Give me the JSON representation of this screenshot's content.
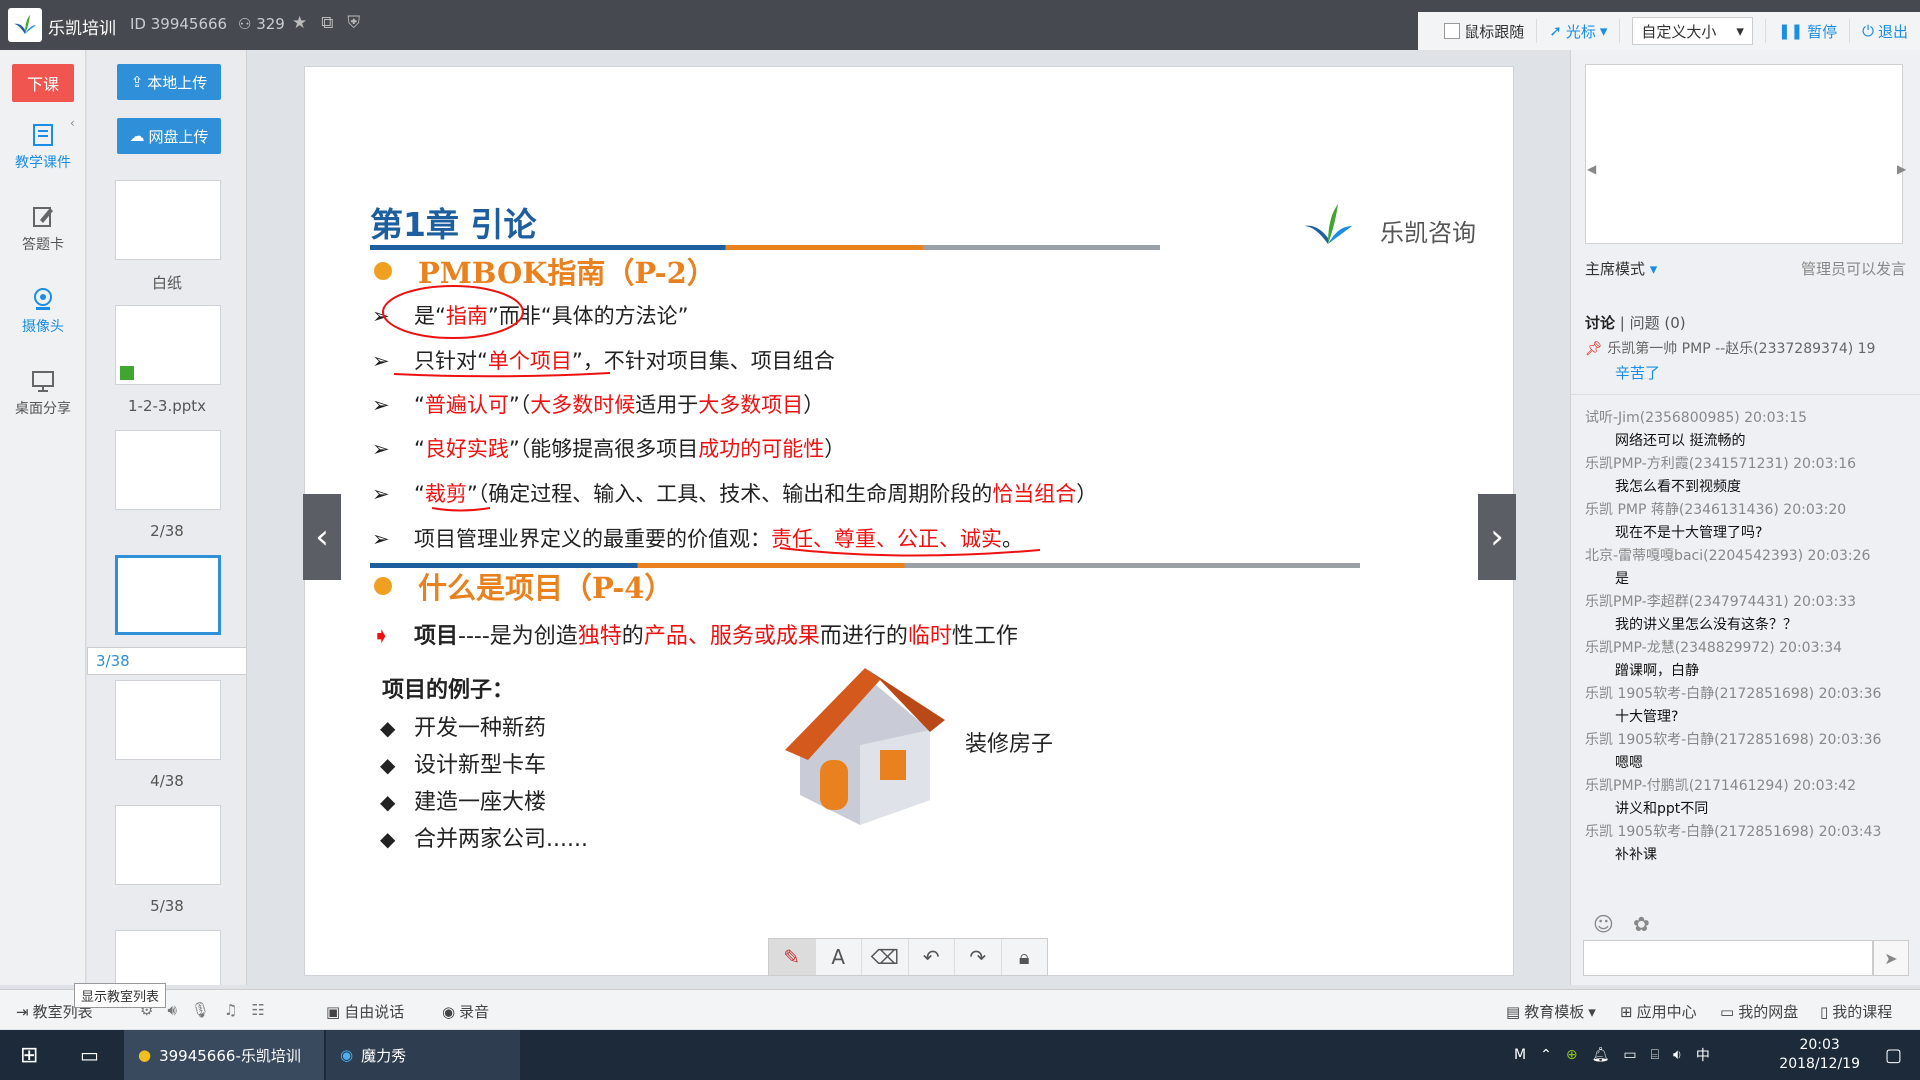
{
  "topbar": {
    "app_title": "乐凯培训",
    "room_id": "ID 39945666",
    "user_count": "329",
    "follow_mouse": "鼠标跟随",
    "cursor": "光标",
    "size_select": "自定义大小",
    "pause": "暂停",
    "exit": "退出"
  },
  "leftnav": {
    "end_class": "下课",
    "items": [
      {
        "label": "教学课件"
      },
      {
        "label": "答题卡"
      },
      {
        "label": "摄像头"
      },
      {
        "label": "桌面分享"
      }
    ]
  },
  "thumbs": {
    "local_upload": "本地上传",
    "cloud_upload": "网盘上传",
    "items": [
      {
        "label": "白纸"
      },
      {
        "label": "1-2-3.pptx"
      },
      {
        "label": "2/38"
      },
      {
        "label": "3/38"
      },
      {
        "label": "4/38"
      },
      {
        "label": "5/38"
      }
    ]
  },
  "slide": {
    "title": "第1章 引论",
    "brand": "乐凯咨询",
    "section1": "PMBOK指南（P-2）",
    "bullets": [
      {
        "parts": [
          "是“",
          "指南",
          "”而非“具体的方法论”"
        ]
      },
      {
        "parts": [
          "只针对“",
          "单个项目",
          "”，不针对项目集、项目组合"
        ]
      },
      {
        "parts": [
          "“",
          "普遍认可",
          "”（",
          "大多数时候",
          "适用于",
          "大多数项目",
          "）"
        ]
      },
      {
        "parts": [
          "“",
          "良好实践",
          "”（能够提高很多项目",
          "成功的可能性",
          "）"
        ]
      },
      {
        "parts": [
          "“",
          "裁剪",
          "”（确定过程、输入、工具、技术、输出和生命周期阶段的",
          "恰当组合",
          "）"
        ]
      },
      {
        "parts": [
          "项目管理业界定义的最重要的价值观：",
          "责任、尊重、公正、诚实",
          "。"
        ]
      }
    ],
    "section2": "什么是项目（P-4）",
    "def": {
      "parts": [
        "项目",
        "----是为创造",
        "独特",
        "的",
        "产品、服务或成果",
        "而进行的",
        "临时",
        "性工作"
      ]
    },
    "examples_title": "项目的例子：",
    "examples": [
      "开发一种新药",
      "设计新型卡车",
      "建造一座大楼",
      "合并两家公司......"
    ],
    "house_label": "装修房子"
  },
  "right": {
    "mode": "主席模式",
    "mode_note": "管理员可以发言",
    "tab_discuss": "讨论",
    "tab_questions": "问题 (0)",
    "pinned_who": "乐凯第一帅 PMP --赵乐(2337289374) 19",
    "pinned_msg": "辛苦了",
    "messages": [
      {
        "who": "试听-Jim(2356800985) 20:03:15",
        "text": "网络还可以 挺流畅的"
      },
      {
        "who": "乐凯PMP-方利霞(2341571231) 20:03:16",
        "text": "我怎么看不到视频度"
      },
      {
        "who": "乐凯 PMP 蒋静(2346131436) 20:03:20",
        "text": "现在不是十大管理了吗?"
      },
      {
        "who": "北京-雷蒂嘎嘎baci(2204542393) 20:03:26",
        "text": "是"
      },
      {
        "who": "乐凯PMP-李超群(2347974431) 20:03:33",
        "text": "我的讲义里怎么没有这条？？"
      },
      {
        "who": "乐凯PMP-龙慧(2348829972) 20:03:34",
        "text": "蹭课啊，白静"
      },
      {
        "who": "乐凯 1905软考-白静(2172851698) 20:03:36",
        "text": "十大管理?"
      },
      {
        "who": "乐凯 1905软考-白静(2172851698) 20:03:36",
        "text": "嗯嗯"
      },
      {
        "who": "乐凯PMP-付鹏凯(2171461294) 20:03:42",
        "text": "讲义和ppt不同"
      },
      {
        "who": "乐凯 1905软考-白静(2172851698) 20:03:43",
        "text": "补补课"
      }
    ]
  },
  "bottombar": {
    "classroom": "教室列表",
    "tooltip": "显示教室列表",
    "free_talk": "自由说话",
    "record": "录音",
    "edu_template": "教育模板",
    "app_center": "应用中心",
    "my_disk": "我的网盘",
    "my_course": "我的课程"
  },
  "taskbar": {
    "app1": "39945666-乐凯培训",
    "app2": "魔力秀",
    "ime": "中",
    "time": "20:03",
    "date": "2018/12/19"
  }
}
